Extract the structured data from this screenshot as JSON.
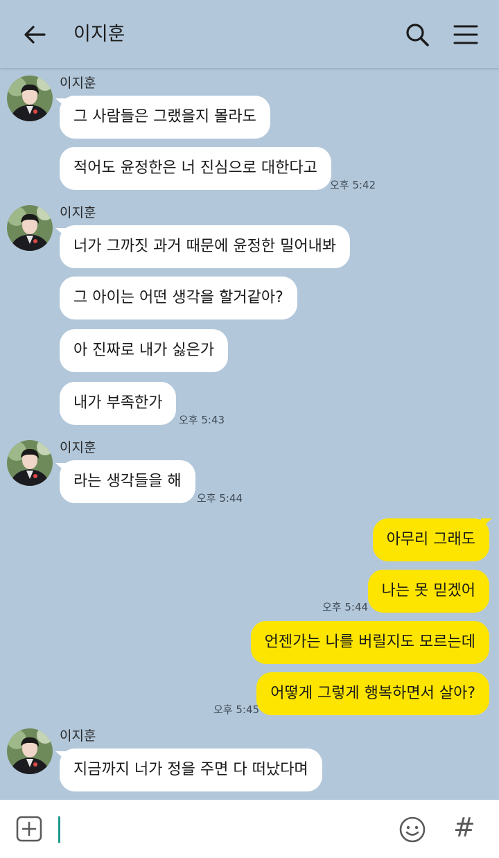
{
  "header": {
    "title": "이지훈",
    "back_icon": "arrow-left-icon",
    "search_icon": "search-icon",
    "menu_icon": "hamburger-menu-icon"
  },
  "messages": [
    {
      "sender": "이지훈",
      "text": "그 사람들은 그랬을지 몰라도"
    },
    {
      "text": "적어도 윤정한은 너 진심으로 대한다고",
      "time": "오후 5:42"
    },
    {
      "sender": "이지훈",
      "text": "너가 그까짓 과거 때문에 윤정한 밀어내봐"
    },
    {
      "text": "그 아이는 어떤 생각을 할거같아?"
    },
    {
      "text": "아 진짜로 내가 싫은가"
    },
    {
      "text": "내가 부족한가",
      "time": "오후 5:43"
    },
    {
      "sender": "이지훈",
      "text": "라는 생각들을 해",
      "time": "오후 5:44"
    },
    {
      "text": "아무리 그래도"
    },
    {
      "text": "나는 못 믿겠어",
      "time": "오후 5:44"
    },
    {
      "text": "언젠가는 나를 버릴지도 모르는데"
    },
    {
      "text": "어떻게 그렇게 행복하면서 살아?",
      "time": "오후 5:45"
    },
    {
      "sender": "이지훈",
      "text": "지금까지 너가 정을 주면 다 떠났다며"
    }
  ],
  "composer": {
    "add_icon": "plus-square-icon",
    "emoji_icon": "emoji-icon",
    "hash_label": "#"
  },
  "colors": {
    "background": "#b2c7da",
    "incoming_bubble": "#ffffff",
    "outgoing_bubble": "#fee500",
    "cursor": "#1f9a8f"
  }
}
